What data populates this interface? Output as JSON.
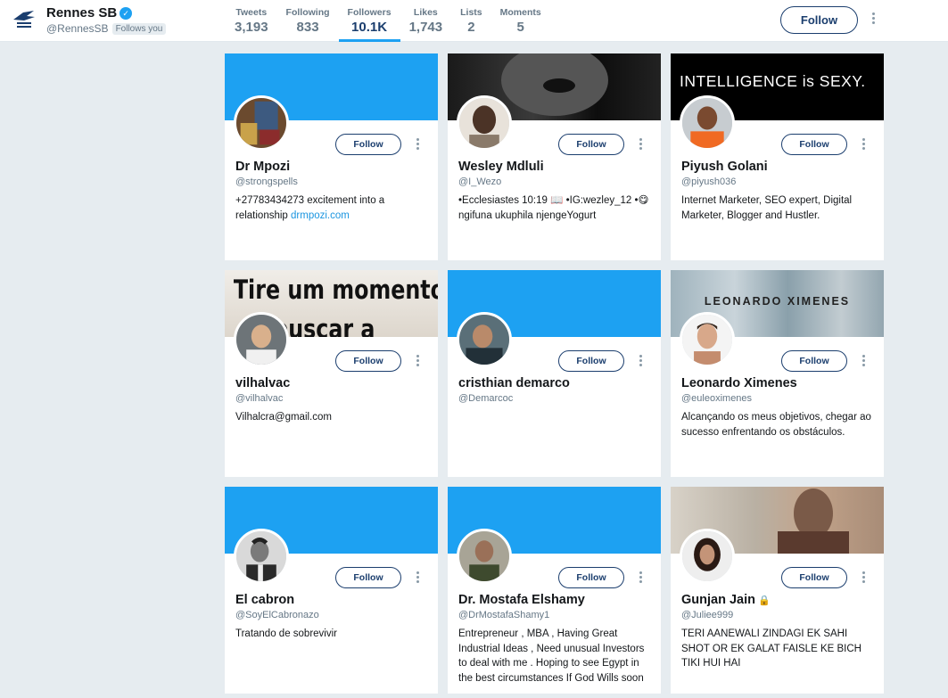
{
  "header": {
    "name": "Rennes SB",
    "handle": "@RennesSB",
    "follows_you": "Follows you",
    "follow_label": "Follow"
  },
  "stats": [
    {
      "label": "Tweets",
      "value": "3,193"
    },
    {
      "label": "Following",
      "value": "833"
    },
    {
      "label": "Followers",
      "value": "10.1K"
    },
    {
      "label": "Likes",
      "value": "1,743"
    },
    {
      "label": "Lists",
      "value": "2"
    },
    {
      "label": "Moments",
      "value": "5"
    }
  ],
  "colors": {
    "accent": "#1da1f2",
    "button": "#1b3e6e",
    "background": "#e6ecf0"
  },
  "follow_label": "Follow",
  "cards": [
    {
      "name": "Dr Mpozi",
      "handle": "@strongspells",
      "bio": "+27783434273 excitement into a relationship ",
      "link": "drmpozi.com",
      "banner": ""
    },
    {
      "name": "Wesley Mdluli",
      "handle": "@I_Wezo",
      "bio": "•Ecclesiastes 10:19 📖 •IG:wezley_12 •😋 ngifuna ukuphila njengeYogurt",
      "link": "",
      "banner": ""
    },
    {
      "name": "Piyush Golani",
      "handle": "@piyush036",
      "bio": "Internet Marketer, SEO expert, Digital Marketer, Blogger and Hustler.",
      "link": "",
      "banner": "INTELLIGENCE is SEXY."
    },
    {
      "name": "vilhalvac",
      "handle": "@vilhalvac",
      "bio": "Vilhalcra@gmail.com",
      "link": "",
      "banner": "Tire um momento\n ra buscar a"
    },
    {
      "name": "cristhian demarco",
      "handle": "@Demarcoc",
      "bio": "",
      "link": "",
      "banner": ""
    },
    {
      "name": "Leonardo Ximenes",
      "handle": "@euleoximenes",
      "bio": "Alcançando os meus objetivos, chegar ao sucesso enfrentando os obstáculos.",
      "link": "",
      "banner": "LEONARDO XIMENES"
    },
    {
      "name": "El cabron",
      "handle": "@SoyElCabronazo",
      "bio": "Tratando de sobrevivir",
      "link": "",
      "banner": ""
    },
    {
      "name": "Dr. Mostafa Elshamy",
      "handle": "@DrMostafaShamy1",
      "bio": "Entrepreneur , MBA , Having Great Industrial Ideas , Need unusual Investors to deal with me . Hoping to see Egypt in the best circumstances If God Wills soon",
      "link": "",
      "banner": ""
    },
    {
      "name": "Gunjan Jain",
      "handle": "@Juliee999",
      "bio": "TERI AANEWALI ZINDAGI EK SAHI SHOT OR EK GALAT FAISLE KE BICH TIKI HUI HAI",
      "link": "",
      "banner": ""
    }
  ]
}
